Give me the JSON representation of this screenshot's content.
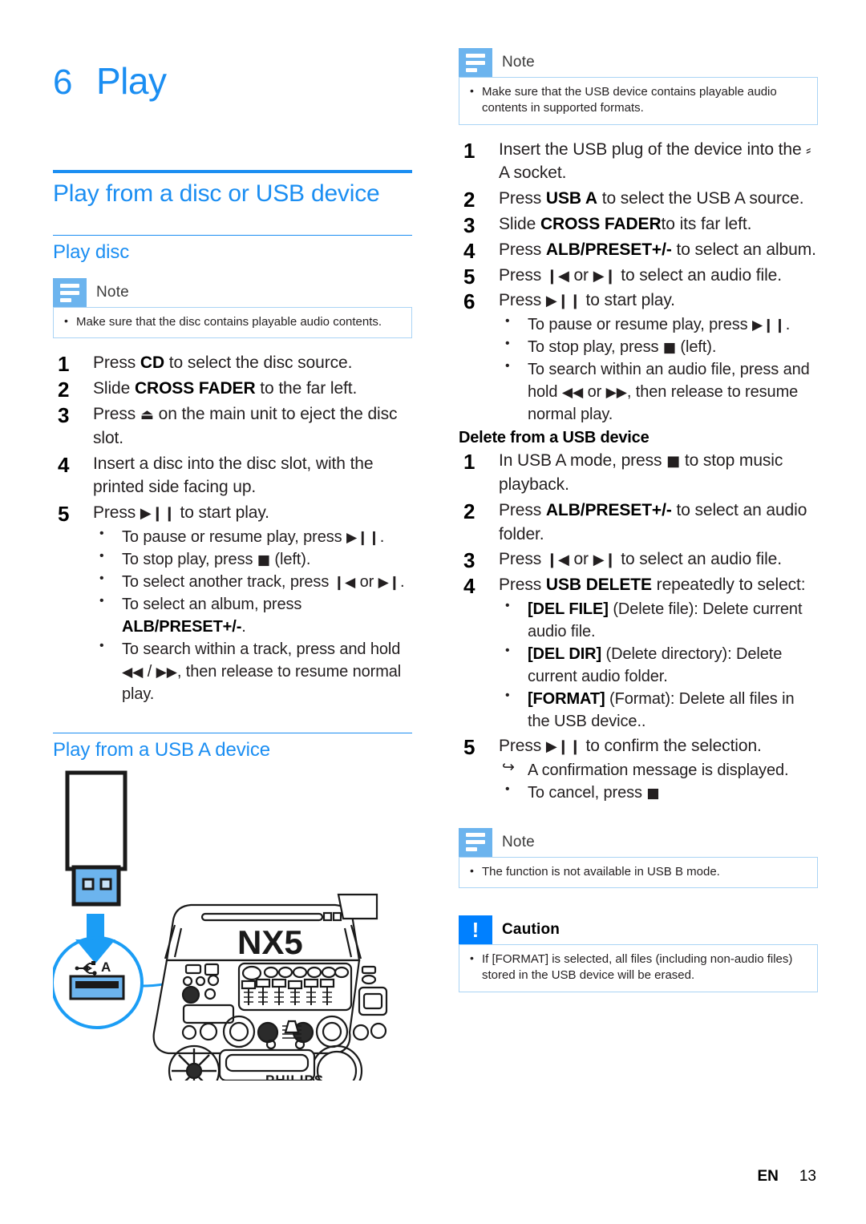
{
  "colors": {
    "accent": "#1b8ef2",
    "note_tab": "#6cb4ee",
    "caution_tab": "#0080ff",
    "note_border": "#aad4f5"
  },
  "chapter": {
    "number": "6",
    "title": "Play"
  },
  "left": {
    "h1": "Play from a disc or USB device",
    "h2_play_disc": "Play disc",
    "note": {
      "title": "Note",
      "items": [
        "Make sure that the disc contains playable audio contents."
      ]
    },
    "steps": [
      {
        "n": "1",
        "pre": "Press ",
        "bold": "CD",
        "post": " to select the disc source."
      },
      {
        "n": "2",
        "pre": "Slide ",
        "bold": "CROSS FADER",
        "post": " to the far left."
      },
      {
        "n": "3",
        "pre": "Press ",
        "glyph": "⏏",
        "post": " on the main unit to eject the disc slot."
      },
      {
        "n": "4",
        "pre": "Insert a disc into the disc slot, with the printed side facing up."
      },
      {
        "n": "5",
        "pre": "Press ",
        "glyph": "▶❙❙",
        "post": " to start play."
      }
    ],
    "substeps": [
      {
        "pre": "To pause or resume play, press ",
        "glyph": "▶❙❙",
        "post": "."
      },
      {
        "pre": "To stop play, press ",
        "glyph": "■",
        "post": " (left)."
      },
      {
        "pre": "To select another track, press ",
        "glyph": "❙◀",
        "mid": " or ",
        "glyph2": "▶❙",
        "post": "."
      },
      {
        "pre": "To select an album, press ",
        "bold": "ALB/PRESET+/-",
        "post": "."
      },
      {
        "pre": "To search within a track, press and hold ",
        "glyph": "◀◀",
        "mid": " / ",
        "glyph2": "▶▶",
        "post": ", then release to resume normal play."
      }
    ],
    "h2_usb_a": "Play from a USB A device",
    "illustration": {
      "product_name": "NX5",
      "brand": "PHILIPS",
      "socket_label": "A",
      "socket_icon": "usb-icon"
    }
  },
  "right": {
    "note_top": {
      "title": "Note",
      "items": [
        "Make sure that the USB device contains playable audio contents in supported formats."
      ]
    },
    "steps": [
      {
        "n": "1",
        "pre": "Insert the USB plug of the device into the ",
        "glyph": "⸗",
        "post": " A socket."
      },
      {
        "n": "2",
        "pre": "Press ",
        "bold": "USB A",
        "post": " to select the USB A source."
      },
      {
        "n": "3",
        "pre": "Slide ",
        "bold": "CROSS FADER",
        "post": "to its far left."
      },
      {
        "n": "4",
        "pre": "Press ",
        "bold": "ALB/PRESET+/-",
        "post": " to select an album."
      },
      {
        "n": "5",
        "pre": "Press ",
        "glyph": "❙◀",
        "mid": " or ",
        "glyph2": "▶❙",
        "post": " to select an audio file."
      },
      {
        "n": "6",
        "pre": "Press ",
        "glyph": "▶❙❙",
        "post": " to start play."
      }
    ],
    "substeps": [
      {
        "pre": "To pause or resume play, press ",
        "glyph": "▶❙❙",
        "post": "."
      },
      {
        "pre": "To stop play, press ",
        "glyph": "■",
        "post": " (left)."
      },
      {
        "pre": "To search within an audio file, press and hold ",
        "glyph": "◀◀",
        "mid": " or ",
        "glyph2": "▶▶",
        "post": ", then release to resume normal play."
      }
    ],
    "h3_delete": "Delete from a USB device",
    "delete_steps": [
      {
        "n": "1",
        "pre": "In USB A mode, press ",
        "glyph": "■",
        "post": " to stop music playback."
      },
      {
        "n": "2",
        "pre": "Press ",
        "bold": "ALB/PRESET+/-",
        "post": " to select an audio folder."
      },
      {
        "n": "3",
        "pre": "Press ",
        "glyph": "❙◀",
        "mid": " or ",
        "glyph2": "▶❙",
        "post": " to select an audio file."
      },
      {
        "n": "4",
        "pre": "Press ",
        "bold": "USB DELETE",
        "post": " repeatedly to select:"
      }
    ],
    "delete_options": [
      {
        "bold": "[DEL FILE]",
        "post": " (Delete file): Delete current audio file."
      },
      {
        "bold": "[DEL DIR]",
        "post": " (Delete directory): Delete current audio folder."
      },
      {
        "bold": "[FORMAT]",
        "post": " (Format): Delete all files in the USB device.."
      }
    ],
    "step5": {
      "n": "5",
      "pre": "Press ",
      "glyph": "▶❙❙",
      "post": " to confirm the selection."
    },
    "step5_subs": [
      {
        "arrow": true,
        "pre": "A confirmation message is displayed."
      },
      {
        "pre": "To cancel, press ",
        "glyph": "■",
        "post": ""
      }
    ],
    "note_bottom": {
      "title": "Note",
      "items": [
        "The function is not available in USB B mode."
      ]
    },
    "caution": {
      "title": "Caution",
      "items": [
        "If [FORMAT] is selected, all files (including non-audio files) stored in the USB device will be erased."
      ]
    }
  },
  "footer": {
    "language": "EN",
    "page": "13"
  }
}
